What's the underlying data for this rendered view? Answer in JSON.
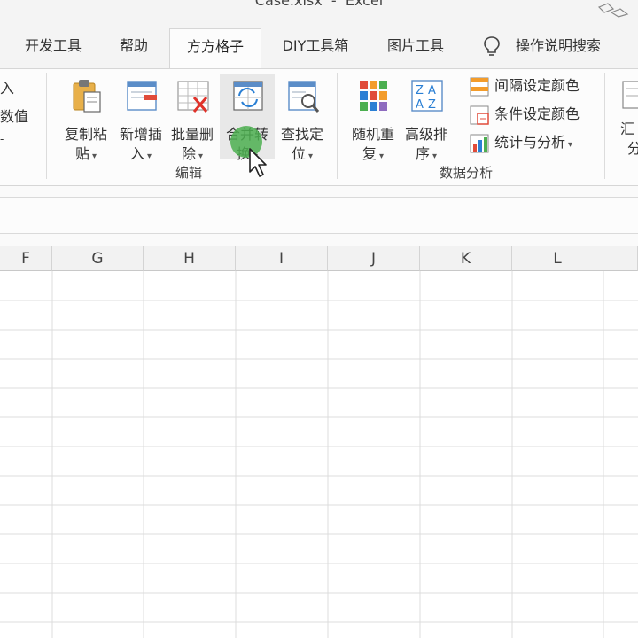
{
  "window": {
    "title": "Case.xlsx  -  Excel"
  },
  "tabs": [
    {
      "label": "开发工具",
      "active": false
    },
    {
      "label": "帮助",
      "active": false
    },
    {
      "label": "方方格子",
      "active": true
    },
    {
      "label": "DIY工具箱",
      "active": false
    },
    {
      "label": "图片工具",
      "active": false
    }
  ],
  "tell_me": {
    "label": "操作说明搜索",
    "icon": "lightbulb-icon"
  },
  "ribbon": {
    "left_cut": {
      "line1": "入",
      "line2": "数值",
      "line3": "-"
    },
    "edit_group": {
      "label": "编辑",
      "buttons": [
        {
          "line1": "复制粘",
          "line2": "贴",
          "icon": "copy-paste-icon"
        },
        {
          "line1": "新增插",
          "line2": "入",
          "icon": "insert-icon"
        },
        {
          "line1": "批量删",
          "line2": "除",
          "icon": "batch-delete-icon"
        },
        {
          "line1": "合并转",
          "line2": "换",
          "icon": "merge-convert-icon"
        },
        {
          "line1": "查找定",
          "line2": "位",
          "icon": "find-locate-icon"
        }
      ]
    },
    "data_group": {
      "label": "数据分析",
      "buttons": [
        {
          "line1": "随机重",
          "line2": "复",
          "icon": "random-repeat-icon"
        },
        {
          "line1": "高级排",
          "line2": "序",
          "icon": "advanced-sort-icon"
        }
      ],
      "small_buttons": [
        {
          "label": "间隔设定颜色",
          "icon": "interval-color-icon"
        },
        {
          "label": "条件设定颜色",
          "icon": "conditional-color-icon"
        },
        {
          "label": "统计与分析",
          "icon": "statistics-icon"
        }
      ]
    },
    "right_cut": {
      "line1": "汇",
      "line2": "分"
    },
    "dropdown_arrow": "▾"
  },
  "columns": [
    "F",
    "G",
    "H",
    "I",
    "J",
    "K",
    "L"
  ],
  "colors": {
    "highlight": "#4caf50",
    "ribbon_bg": "#fcfcfc",
    "tab_bg": "#f4f4f4"
  }
}
